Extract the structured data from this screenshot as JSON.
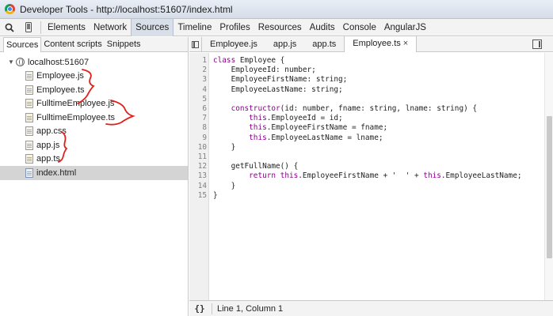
{
  "window": {
    "title": "Developer Tools - http://localhost:51607/index.html"
  },
  "toolbar": {
    "tabs": [
      "Elements",
      "Network",
      "Sources",
      "Timeline",
      "Profiles",
      "Resources",
      "Audits",
      "Console",
      "AngularJS"
    ],
    "active_tab": "Sources"
  },
  "navigator": {
    "tabs": [
      "Sources",
      "Content scripts",
      "Snippets"
    ],
    "active_tab": "Sources",
    "root": "localhost:51607",
    "files": [
      "Employee.js",
      "Employee.ts",
      "FulltimeEmployee.js",
      "FulltimeEmployee.ts",
      "app.css",
      "app.js",
      "app.ts",
      "index.html"
    ],
    "selected_file": "index.html"
  },
  "editor": {
    "tabs": [
      "Employee.js",
      "app.js",
      "app.ts",
      "Employee.ts"
    ],
    "active_tab": "Employee.ts",
    "close_glyph": "×",
    "line_numbers": [
      "1",
      "2",
      "3",
      "4",
      "5",
      "6",
      "7",
      "8",
      "9",
      "10",
      "11",
      "12",
      "13",
      "14",
      "15"
    ],
    "lines": [
      "class Employee {",
      "    EmployeeId: number;",
      "    EmployeeFirstName: string;",
      "    EmployeeLastName: string;",
      "",
      "    constructor(id: number, fname: string, lname: string) {",
      "        this.EmployeeId = id;",
      "        this.EmployeeFirstName = fname;",
      "        this.EmployeeLastName = lname;",
      "    }",
      "",
      "    getFullName() {",
      "        return this.EmployeeFirstName + '  ' + this.EmployeeLastName;",
      "    }",
      "}"
    ]
  },
  "statusbar": {
    "pretty_print_label": "{}",
    "cursor_position": "Line 1, Column 1"
  },
  "colors": {
    "keyword": "#8b008b",
    "annotation": "#e0201b",
    "selected_row": "#d4d4d4"
  }
}
